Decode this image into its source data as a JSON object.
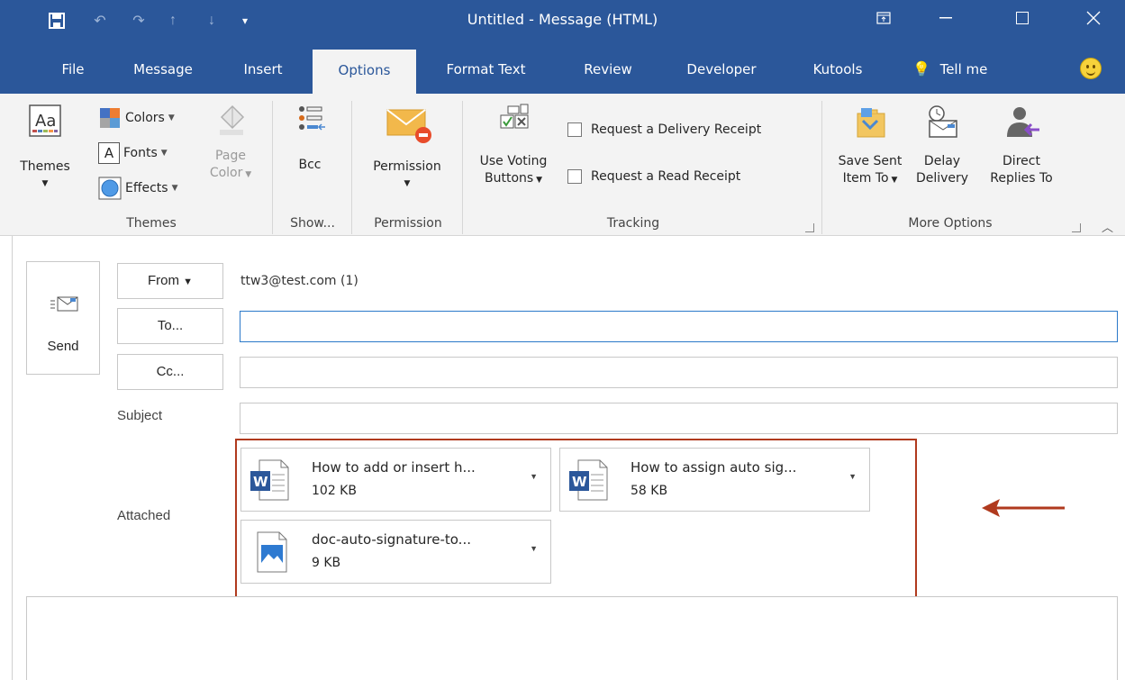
{
  "window": {
    "title": "Untitled - Message (HTML)"
  },
  "tabs": [
    "File",
    "Message",
    "Insert",
    "Options",
    "Format Text",
    "Review",
    "Developer",
    "Kutools",
    "Tell me"
  ],
  "ribbon": {
    "themes_group": {
      "themes": "Themes",
      "colors": "Colors",
      "fonts": "Fonts",
      "effects": "Effects",
      "page_color_line1": "Page",
      "page_color_line2": "Color",
      "label": "Themes"
    },
    "show_group": {
      "bcc": "Bcc",
      "label": "Show..."
    },
    "permission_group": {
      "permission": "Permission",
      "label": "Permission"
    },
    "tracking_group": {
      "voting_line1": "Use Voting",
      "voting_line2": "Buttons",
      "delivery_receipt": "Request a Delivery Receipt",
      "read_receipt": "Request a Read Receipt",
      "label": "Tracking"
    },
    "more_group": {
      "save_sent_line1": "Save Sent",
      "save_sent_line2": "Item To",
      "delay_line1": "Delay",
      "delay_line2": "Delivery",
      "direct_line1": "Direct",
      "direct_line2": "Replies To",
      "label": "More Options"
    }
  },
  "compose": {
    "send": "Send",
    "from_button": "From",
    "from_value": "ttw3@test.com (1)",
    "to_button": "To...",
    "cc_button": "Cc...",
    "subject_label": "Subject",
    "attached_label": "Attached",
    "to_value": "",
    "cc_value": "",
    "subject_value": ""
  },
  "attachments": [
    {
      "name": "How to add or insert h...",
      "size": "102 KB",
      "type": "word"
    },
    {
      "name": "How to assign auto sig...",
      "size": "58 KB",
      "type": "word"
    },
    {
      "name": "doc-auto-signature-to...",
      "size": "9 KB",
      "type": "image"
    }
  ],
  "colors": {
    "brand": "#2b579a",
    "highlight": "#b03a1e"
  }
}
